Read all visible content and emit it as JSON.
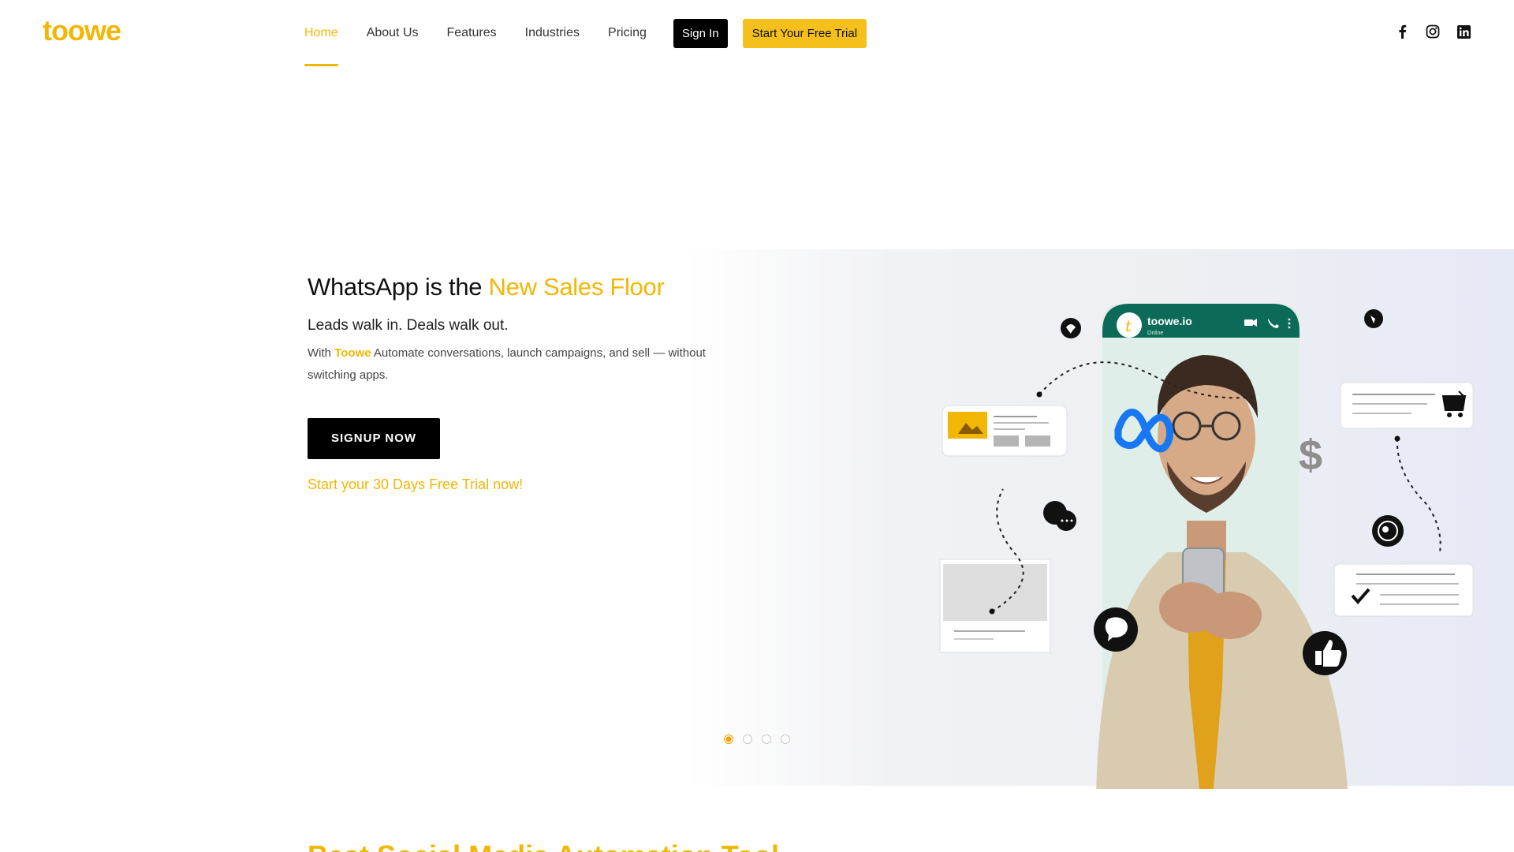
{
  "brand": {
    "logo_text": "toowe"
  },
  "nav": {
    "items": [
      {
        "label": "Home",
        "active": true
      },
      {
        "label": "About Us",
        "active": false
      },
      {
        "label": "Features",
        "active": false
      },
      {
        "label": "Industries",
        "active": false
      },
      {
        "label": "Pricing",
        "active": false
      }
    ],
    "signin_label": "Sign In",
    "trial_label": "Start Your Free Trial"
  },
  "social": {
    "icons": [
      "facebook-icon",
      "instagram-icon",
      "linkedin-icon"
    ]
  },
  "hero": {
    "title_part1": "WhatsApp is the ",
    "title_accent": "New Sales Floor",
    "subtitle": "Leads walk in. Deals walk out.",
    "desc_prefix": "With ",
    "desc_brand": "Toowe",
    "desc_rest": " Automate conversations, launch campaigns, and sell — without switching apps.",
    "signup_label": "SIGNUP NOW",
    "trial_link": "Start your 30 Days Free Trial now!"
  },
  "illustration": {
    "chat_name": "toowe.io",
    "chat_status": "Online"
  },
  "carousel": {
    "slides": 4,
    "active_index": 0
  },
  "next_section": {
    "heading": "Best Social Media Automation Tool"
  },
  "colors": {
    "accent": "#f2b705",
    "dark": "#000000",
    "whatsapp_green": "#0c6b58"
  }
}
